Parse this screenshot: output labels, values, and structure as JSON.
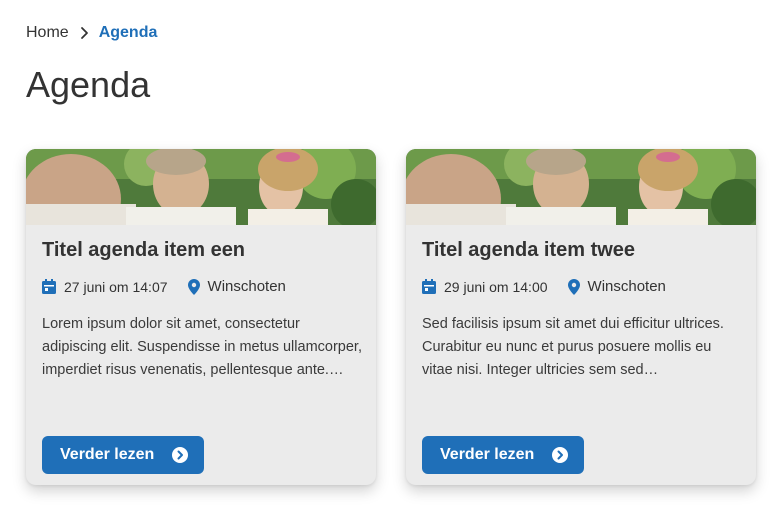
{
  "breadcrumb": {
    "home": "Home",
    "current": "Agenda"
  },
  "page": {
    "title": "Agenda"
  },
  "cards": [
    {
      "title": "Titel agenda item een",
      "date": "27 juni om 14:07",
      "location": "Winschoten",
      "excerpt": "Lorem ipsum dolor sit amet, consectetur adipiscing elit. Suspendisse in metus ullamcorper, imperdiet risus venenatis, pellentesque ante.…",
      "button": "Verder lezen"
    },
    {
      "title": "Titel agenda item twee",
      "date": "29 juni om 14:00",
      "location": "Winschoten",
      "excerpt": "Sed facilisis ipsum sit amet dui efficitur ultrices. Curabitur eu nunc et purus posuere mollis eu vitae nisi. Integer ultricies sem sed…",
      "button": "Verder lezen"
    }
  ],
  "colors": {
    "accent": "#1f6fb8",
    "card_bg": "#ebebeb",
    "text": "#333333"
  },
  "icons": {
    "breadcrumb_separator": "chevron-right-icon",
    "date": "calendar-icon",
    "location": "map-pin-icon",
    "button": "arrow-right-circle-icon"
  }
}
